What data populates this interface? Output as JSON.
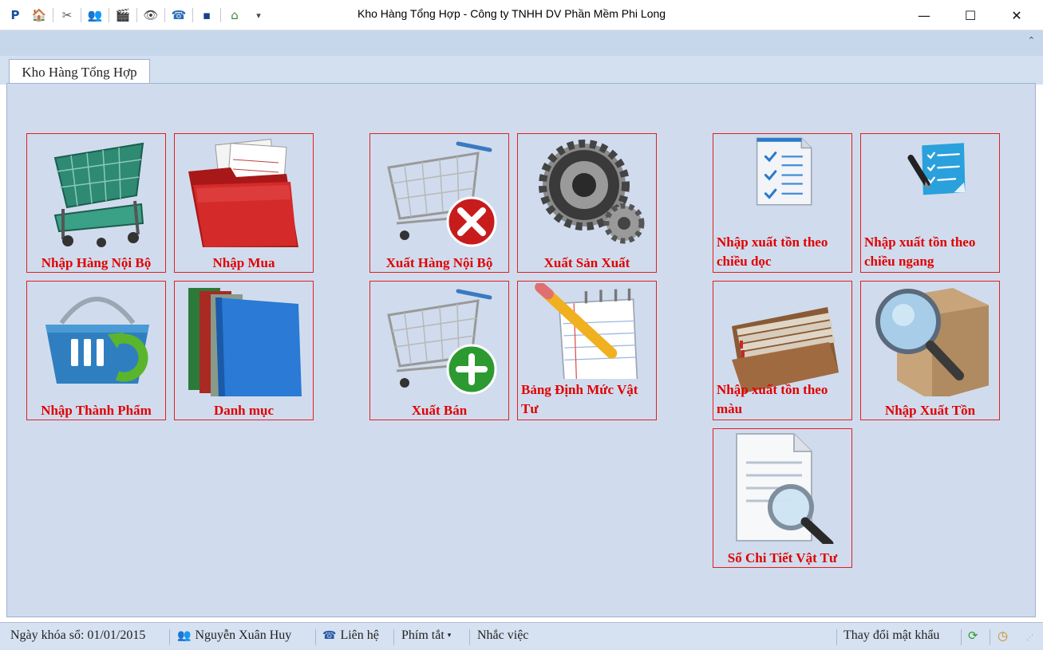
{
  "window": {
    "title": "Kho Hàng Tổng Hợp - Công ty TNHH DV Phần Mềm Phi Long",
    "logo_text": "P",
    "minimize": "—",
    "maximize": "☐",
    "close": "✕"
  },
  "quick_access": [
    {
      "icon": "home-icon",
      "glyph": "🏠"
    },
    {
      "icon": "tools-icon",
      "glyph": "✂"
    },
    {
      "icon": "users-icon",
      "glyph": "👥"
    },
    {
      "icon": "clapper-icon",
      "glyph": "🎬"
    },
    {
      "icon": "eye-icon",
      "glyph": "👁"
    },
    {
      "icon": "phone-icon",
      "glyph": "☎"
    },
    {
      "icon": "window-icon",
      "glyph": "▪"
    },
    {
      "icon": "house-icon",
      "glyph": "⌂"
    },
    {
      "icon": "customize-icon",
      "glyph": "▾"
    }
  ],
  "ribbon": {
    "collapse_glyph": "⌃"
  },
  "tabs": [
    {
      "label": "Kho Hàng Tổng Hợp"
    }
  ],
  "tiles": {
    "nhap_hang_noi_bo": "Nhập Hàng Nội Bộ",
    "nhap_mua": "Nhập Mua",
    "xuat_hang_noi_bo": "Xuất Hàng Nội Bộ",
    "xuat_san_xuat": "Xuất Sản Xuất",
    "nxt_chieu_doc": "Nhập xuất tồn theo chiều dọc",
    "nxt_chieu_ngang": "Nhập xuất tồn theo chiều ngang",
    "nhap_thanh_pham": "Nhập Thành Phẩm",
    "danh_muc": "Danh mục",
    "xuat_ban": "Xuất Bán",
    "bang_dinh_muc": "Bảng Định Mức Vật Tư",
    "nxt_mau": "Nhập xuất tồn theo màu",
    "nhap_xuat_ton": "Nhập Xuất Tồn",
    "so_chi_tiet": "Sổ Chi Tiết Vật Tư"
  },
  "colors": {
    "tile_border": "#e02020",
    "tile_label": "#e00000",
    "panel_bg": "#d0dced"
  },
  "statusbar": {
    "lock_date": "Ngày khóa sổ: 01/01/2015",
    "user": "Nguyễn Xuân Huy",
    "contact": "Liên hệ",
    "shortcuts": "Phím tắt",
    "shortcuts_arrow": "▾",
    "reminders": "Nhắc việc",
    "change_password": "Thay đổi mật khẩu"
  }
}
